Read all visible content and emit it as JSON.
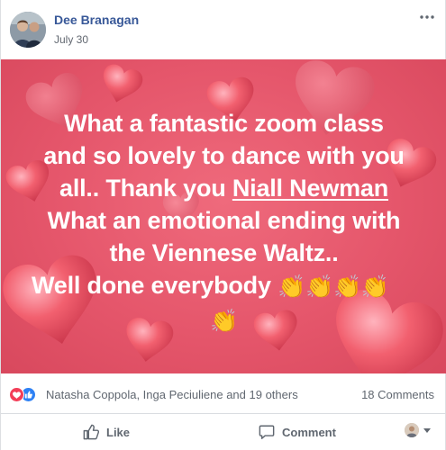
{
  "post": {
    "author": "Dee Branagan",
    "date": "July 30",
    "icons": {
      "more": "more-horizontal-icon"
    }
  },
  "hero": {
    "colors": {
      "background": "#e5566b",
      "text": "#ffffff"
    },
    "lines": {
      "l1": "What a fantastic zoom class",
      "l2": "and so lovely to dance with you",
      "l3_pre": "all.. Thank you ",
      "l3_mention": "Niall Newman",
      "l4": "What an emotional ending with",
      "l5": "the Viennese Waltz..",
      "l6": "Well done everybody "
    },
    "emoji": "👏"
  },
  "stats": {
    "reaction_icons": [
      "love-icon",
      "like-icon"
    ],
    "reactors": "Natasha Coppola, Inga Peciuliene and 19 others",
    "comments": "18 Comments"
  },
  "actions": {
    "like": "Like",
    "comment": "Comment",
    "icons": {
      "like": "thumbs-up-icon",
      "comment": "comment-bubble-icon",
      "viewer": "viewer-avatar",
      "caret": "caret-down-icon"
    }
  },
  "colors": {
    "link": "#385898",
    "muted": "#606770",
    "love": "#f33e58",
    "like": "#2e81f4"
  }
}
